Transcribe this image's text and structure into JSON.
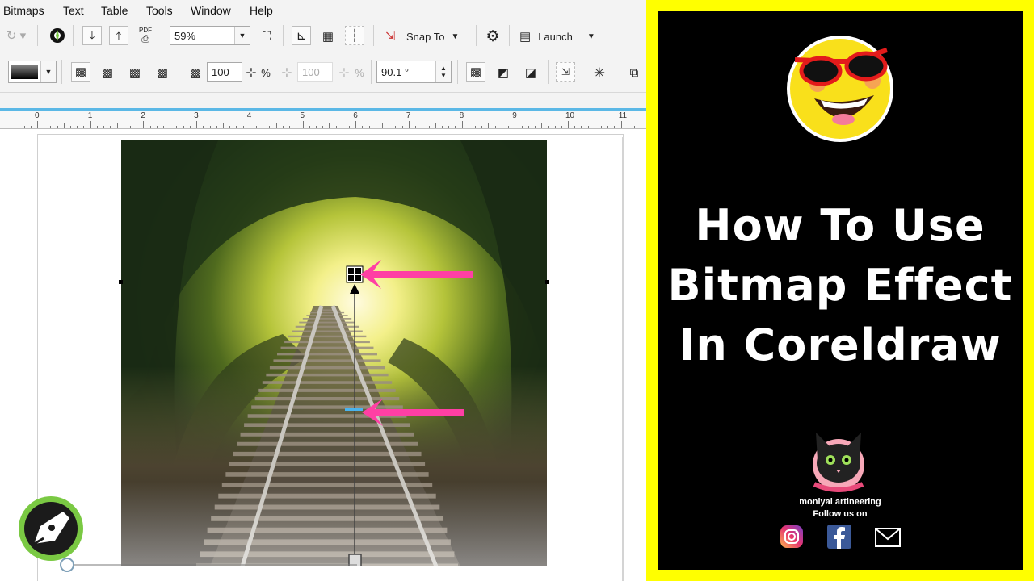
{
  "menubar": {
    "items": [
      "Bitmaps",
      "Text",
      "Table",
      "Tools",
      "Window",
      "Help"
    ]
  },
  "toolbar": {
    "pdf_label": "PDF",
    "zoom_value": "59%",
    "snap_to_label": "Snap To",
    "launch_label": "Launch"
  },
  "property_bar": {
    "transparency_value": "100",
    "transparency_unit": "%",
    "midpoint_value": "100",
    "midpoint_unit": "%",
    "angle_value": "90.1 °"
  },
  "ruler": {
    "labels": [
      "0",
      "1",
      "2",
      "3",
      "4",
      "5",
      "6",
      "7",
      "8",
      "9",
      "10",
      "11"
    ]
  },
  "promo": {
    "title_lines": [
      "How To Use",
      "Bitmap Effect",
      "In Coreldraw"
    ],
    "brand_name": "moniyal artineering",
    "follow_text": "Follow us on"
  },
  "colors": {
    "accent_blue": "#5bb8e6",
    "arrow_pink": "#ff3fa4",
    "panel_yellow": "#ffff00",
    "corel_green": "#7ac943"
  },
  "icons": [
    "new-icon",
    "corel-connect-icon",
    "import-icon",
    "export-icon",
    "publish-pdf-icon",
    "full-screen-icon",
    "rulers-icon",
    "grid-icon",
    "guidelines-icon",
    "snap-off-icon",
    "settings-icon",
    "launch-icon",
    "instagram-icon",
    "facebook-icon",
    "mail-icon"
  ]
}
